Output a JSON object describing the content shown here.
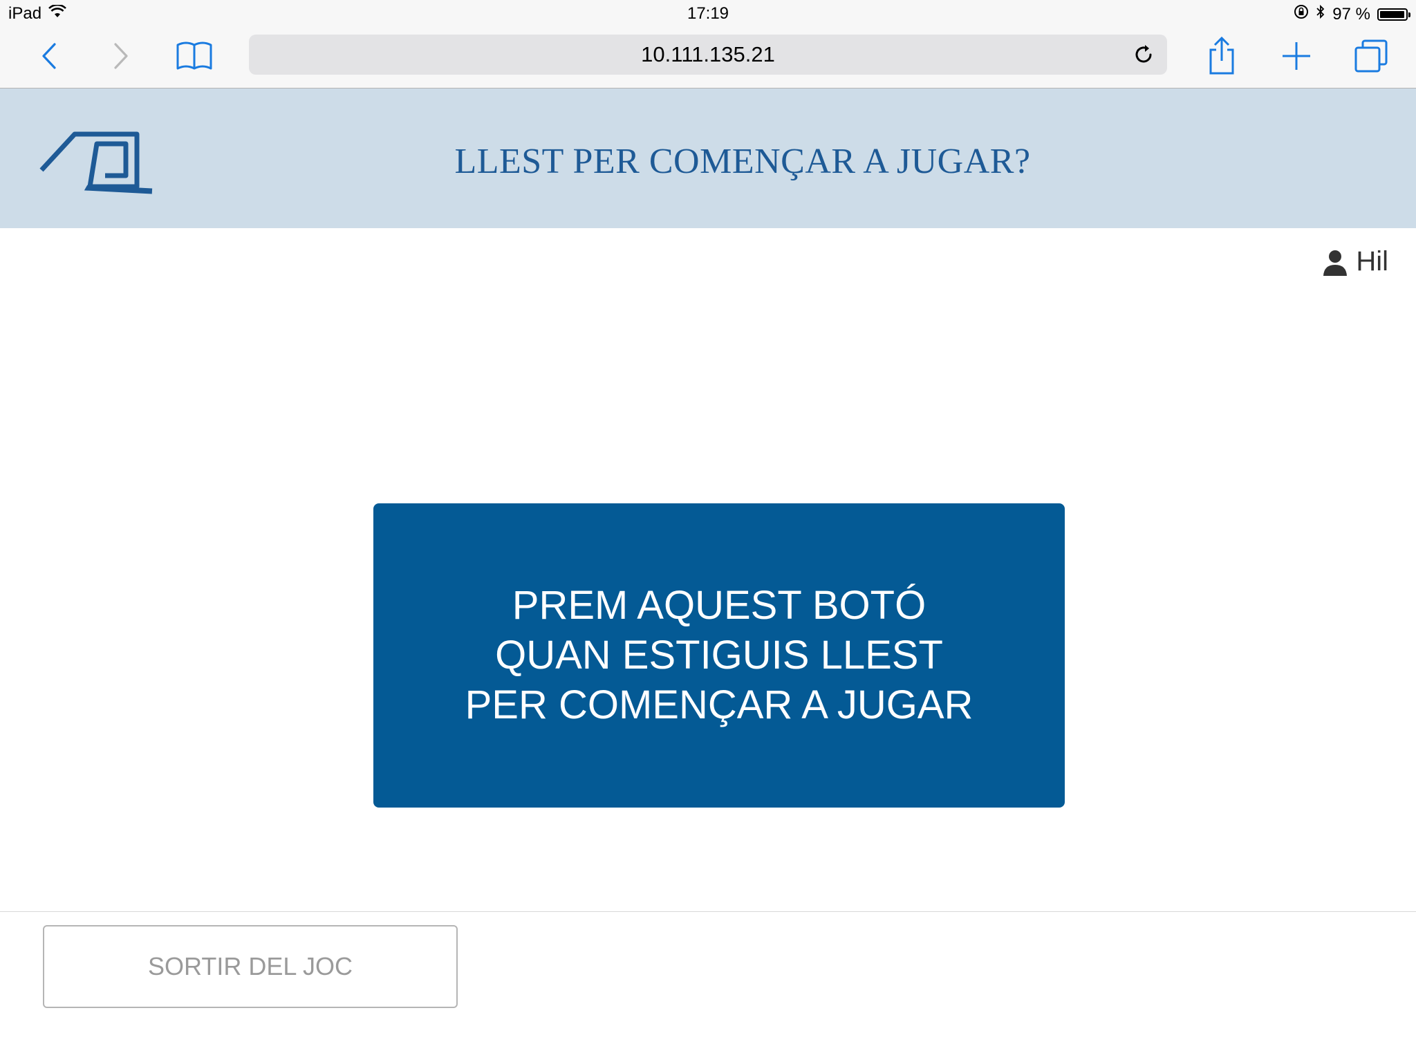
{
  "status_bar": {
    "device": "iPad",
    "time": "17:19",
    "battery": "97 %",
    "battery_level": 0.97
  },
  "browser": {
    "url": "10.111.135.21",
    "icons": [
      "back-icon",
      "forward-icon",
      "bookmarks-icon",
      "reload-icon",
      "share-icon",
      "new-tab-icon",
      "tabs-icon"
    ],
    "accent_color": "#1a7be0"
  },
  "header": {
    "title": "LLEST PER COMENÇAR A JUGAR?",
    "background_color": "#cddce8",
    "title_color": "#1e5a96"
  },
  "user": {
    "name": "Hil"
  },
  "main": {
    "start_button": {
      "line1": "PREM AQUEST BOTÓ",
      "line2": "QUAN ESTIGUIS LLEST",
      "line3": "PER COMENÇAR A JUGAR",
      "color": "#045a95"
    }
  },
  "footer": {
    "exit_label": "SORTIR DEL JOC"
  }
}
